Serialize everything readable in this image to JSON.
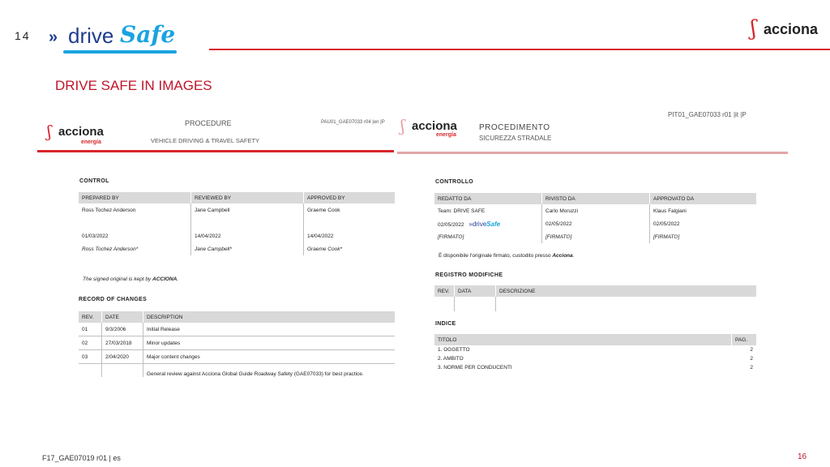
{
  "header": {
    "slide_number": "14",
    "drivesafe_logo": {
      "arrows": "»",
      "drive": "drive",
      "safe": "Safe"
    },
    "acciona_logo": "acciona"
  },
  "section_title": "DRIVE SAFE IN IMAGES",
  "footer": {
    "code": "F17_GAE07019 r01 | es",
    "page": "16"
  },
  "colors": {
    "accent_red": "#d7262c",
    "title_red": "#c0152a",
    "drivesafe_blue": "#1f3c8f",
    "drivesafe_cyan": "#1aa3e0"
  },
  "left_doc": {
    "logo": {
      "word": "acciona",
      "sub": "energía"
    },
    "doc_type": "PROCEDURE",
    "subtitle": "VEHICLE DRIVING & TRAVEL SAFETY",
    "code": "PAU01_GAE07033 r04 |en |P",
    "control_title": "CONTROL",
    "control_headers": [
      "PREPARED BY",
      "REVIEWED BY",
      "APPROVED BY"
    ],
    "control_names": [
      "Ross Tochez Anderson",
      "Jane Campbell",
      "Graeme Cook"
    ],
    "control_dates": [
      "01/03/2022",
      "14/04/2022",
      "14/04/2022"
    ],
    "control_signed": [
      "Ross Tochez Anderson*",
      "Jane Campbell*",
      "Graeme Cook*"
    ],
    "signed_note": "The signed original is kept by",
    "signed_note_company": "ACCIONA",
    "changes_title": "RECORD OF CHANGES",
    "changes_headers": [
      "REV.",
      "DATE",
      "DESCRIPTION"
    ],
    "changes_rows": [
      {
        "rev": "01",
        "date": "9/3/2006",
        "desc": "Initial Release"
      },
      {
        "rev": "02",
        "date": "27/03/2018",
        "desc": "Minor updates"
      },
      {
        "rev": "03",
        "date": "2/04/2020",
        "desc": "Major content changes"
      },
      {
        "rev": "",
        "date": "",
        "desc": "General review against Acciona Global Guide Roadway Safety (GAE07033) for best practice."
      }
    ]
  },
  "right_doc": {
    "logo": {
      "word": "acciona",
      "sub": "energía"
    },
    "doc_type": "PROCEDIMENTO",
    "subtitle": "SICUREZZA STRADALE",
    "code": "PIT01_GAE07033 r01 |it |P",
    "control_title": "CONTROLLO",
    "control_headers": [
      "REDATTO DA",
      "RIVISTO DA",
      "APPROVATO DA"
    ],
    "control_names": [
      "Team: DRIVE SAFE",
      "Carlo Moruzzi",
      "Klaus Falgiani"
    ],
    "control_dates": [
      "02/05/2022",
      "02/05/2022",
      "02/05/2022"
    ],
    "control_signed": [
      "[FIRMATO]",
      "[FIRMATO]",
      "[FIRMATO]"
    ],
    "mini_logo": {
      "drive": "drive",
      "safe": "Safe"
    },
    "signed_note": "È disponibile l'originale firmato, custodito presso",
    "signed_note_company": "Acciona",
    "changes_title": "REGISTRO MODIFICHE",
    "changes_headers": [
      "REV.",
      "DATA",
      "DESCRIZIONE"
    ],
    "index_title": "INDICE",
    "index_headers": [
      "TITOLO",
      "PAG."
    ],
    "index_rows": [
      {
        "title": "1. OGGETTO",
        "page": "2"
      },
      {
        "title": "2. AMBITO",
        "page": "2"
      },
      {
        "title": "3. NORME PER CONDUCENTI",
        "page": "2"
      }
    ]
  }
}
